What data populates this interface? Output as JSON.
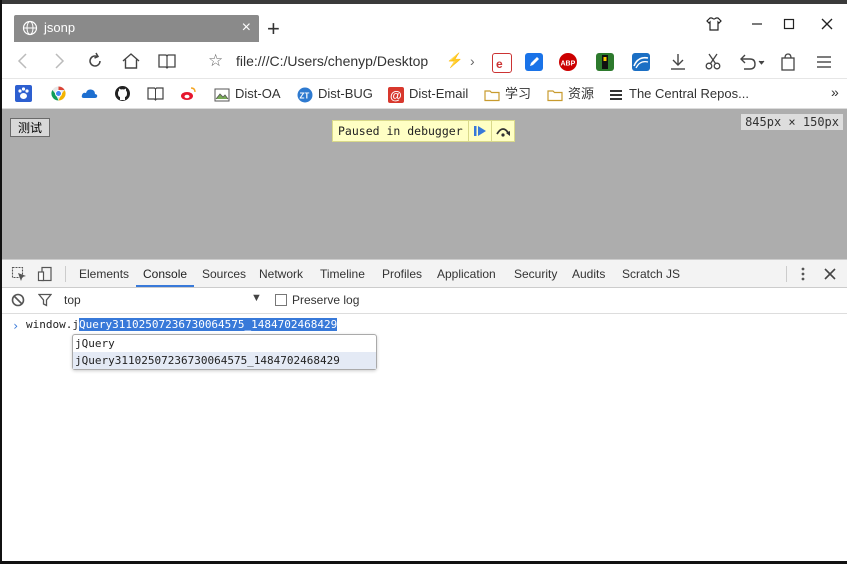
{
  "browser": {
    "tab_title": "jsonp",
    "url": "file:///C:/Users/chenyp/Desktop",
    "window_controls": [
      "minimize",
      "maximize",
      "close"
    ]
  },
  "bookmarks": [
    {
      "label": "Dist-OA",
      "icon": "image-icon"
    },
    {
      "label": "Dist-BUG",
      "icon": "zt-icon"
    },
    {
      "label": "Dist-Email",
      "icon": "at-icon"
    },
    {
      "label": "学习",
      "icon": "folder-icon"
    },
    {
      "label": "资源",
      "icon": "folder-icon"
    },
    {
      "label": "The Central Repos...",
      "icon": "repo-icon"
    }
  ],
  "page": {
    "button_label": "测试",
    "paused_text": "Paused in debugger",
    "dimensions": "845px × 150px"
  },
  "devtools": {
    "tabs": [
      "Elements",
      "Console",
      "Sources",
      "Network",
      "Timeline",
      "Profiles",
      "Application",
      "Security",
      "Audits",
      "Scratch JS"
    ],
    "active_tab": "Console",
    "context": "top",
    "preserve_log_label": "Preserve log",
    "input_typed": "window.j",
    "input_completion": "Query31102507236730064575_1484702468429",
    "suggestions": [
      "jQuery",
      "jQuery31102507236730064575_1484702468429"
    ]
  },
  "colors": {
    "accent": "#3879d9",
    "viewport_bg": "#adadad",
    "tab_bg": "#8a8a8a",
    "paused_bg": "#ffffc4"
  }
}
